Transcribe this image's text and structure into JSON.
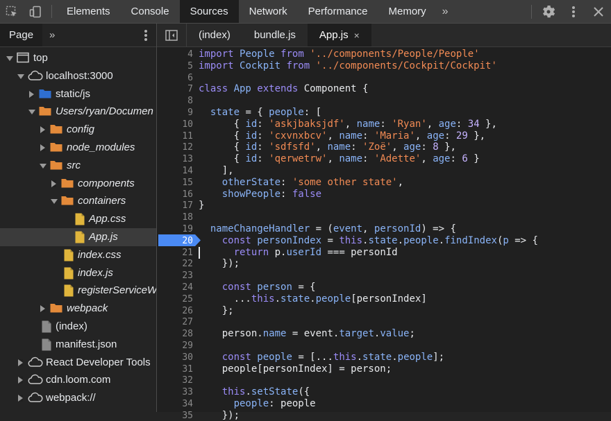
{
  "toolbar": {
    "tabs": [
      "Elements",
      "Console",
      "Sources",
      "Network",
      "Performance",
      "Memory"
    ],
    "active_tab": "Sources",
    "more_label": "»"
  },
  "navigator": {
    "tab_label": "Page",
    "more_label": "»",
    "tree": [
      {
        "label": "top",
        "depth": 0,
        "expanded": true,
        "icon": "frame-icon"
      },
      {
        "label": "localhost:3000",
        "depth": 1,
        "expanded": true,
        "icon": "cloud-icon"
      },
      {
        "label": "static/js",
        "depth": 2,
        "expanded": false,
        "icon": "folder-blue-icon"
      },
      {
        "label": "Users/ryan/Documen",
        "depth": 2,
        "expanded": true,
        "icon": "folder-orange-icon",
        "italic": true
      },
      {
        "label": "config",
        "depth": 3,
        "expanded": false,
        "icon": "folder-orange-icon",
        "italic": true
      },
      {
        "label": "node_modules",
        "depth": 3,
        "expanded": false,
        "icon": "folder-orange-icon",
        "italic": true
      },
      {
        "label": "src",
        "depth": 3,
        "expanded": true,
        "icon": "folder-orange-icon",
        "italic": true
      },
      {
        "label": "components",
        "depth": 4,
        "expanded": false,
        "icon": "folder-orange-icon",
        "italic": true
      },
      {
        "label": "containers",
        "depth": 4,
        "expanded": true,
        "icon": "folder-orange-icon",
        "italic": true
      },
      {
        "label": "App.css",
        "depth": 5,
        "icon": "file-icon",
        "italic": true
      },
      {
        "label": "App.js",
        "depth": 5,
        "icon": "file-icon",
        "italic": true,
        "selected": true
      },
      {
        "label": "index.css",
        "depth": 4,
        "icon": "file-icon",
        "italic": true
      },
      {
        "label": "index.js",
        "depth": 4,
        "icon": "file-icon",
        "italic": true
      },
      {
        "label": "registerServiceW",
        "depth": 4,
        "icon": "file-icon",
        "italic": true
      },
      {
        "label": "webpack",
        "depth": 3,
        "expanded": false,
        "icon": "folder-orange-icon",
        "italic": true
      },
      {
        "label": "(index)",
        "depth": 2,
        "icon": "file-gray-icon"
      },
      {
        "label": "manifest.json",
        "depth": 2,
        "icon": "file-gray-icon"
      },
      {
        "label": "React Developer Tools",
        "depth": 1,
        "expanded": false,
        "icon": "cloud-icon"
      },
      {
        "label": "cdn.loom.com",
        "depth": 1,
        "expanded": false,
        "icon": "cloud-icon"
      },
      {
        "label": "webpack://",
        "depth": 1,
        "expanded": false,
        "icon": "cloud-icon"
      }
    ]
  },
  "editor": {
    "tabs": [
      {
        "label": "(index)",
        "active": false
      },
      {
        "label": "bundle.js",
        "active": false
      },
      {
        "label": "App.js",
        "active": true,
        "close": "×"
      }
    ],
    "breakpoint_line": 20,
    "cursor_line": 21,
    "lines": [
      {
        "n": "4",
        "tokens": [
          [
            "k",
            "import "
          ],
          [
            "p",
            "People "
          ],
          [
            "k",
            "from "
          ],
          [
            "s",
            "'../components/People/People'"
          ]
        ]
      },
      {
        "n": "5",
        "tokens": [
          [
            "k",
            "import "
          ],
          [
            "p",
            "Cockpit "
          ],
          [
            "k",
            "from "
          ],
          [
            "s",
            "'../components/Cockpit/Cockpit'"
          ]
        ]
      },
      {
        "n": "6",
        "tokens": []
      },
      {
        "n": "7",
        "tokens": [
          [
            "k",
            "class "
          ],
          [
            "p",
            "App "
          ],
          [
            "k",
            "extends "
          ],
          [
            "m",
            "Component {"
          ]
        ]
      },
      {
        "n": "8",
        "tokens": []
      },
      {
        "n": "9",
        "tokens": [
          [
            "m",
            "  "
          ],
          [
            "p",
            "state "
          ],
          [
            "m",
            "= { "
          ],
          [
            "p",
            "people"
          ],
          [
            "m",
            ": ["
          ]
        ]
      },
      {
        "n": "10",
        "tokens": [
          [
            "m",
            "      { "
          ],
          [
            "p",
            "id"
          ],
          [
            "m",
            ": "
          ],
          [
            "s",
            "'askjbaksjdf'"
          ],
          [
            "m",
            ", "
          ],
          [
            "p",
            "name"
          ],
          [
            "m",
            ": "
          ],
          [
            "s",
            "'Ryan'"
          ],
          [
            "m",
            ", "
          ],
          [
            "p",
            "age"
          ],
          [
            "m",
            ": "
          ],
          [
            "n",
            "34"
          ],
          [
            "m",
            " },"
          ]
        ]
      },
      {
        "n": "11",
        "tokens": [
          [
            "m",
            "      { "
          ],
          [
            "p",
            "id"
          ],
          [
            "m",
            ": "
          ],
          [
            "s",
            "'cxvnxbcv'"
          ],
          [
            "m",
            ", "
          ],
          [
            "p",
            "name"
          ],
          [
            "m",
            ": "
          ],
          [
            "s",
            "'Maria'"
          ],
          [
            "m",
            ", "
          ],
          [
            "p",
            "age"
          ],
          [
            "m",
            ": "
          ],
          [
            "n",
            "29"
          ],
          [
            "m",
            " },"
          ]
        ]
      },
      {
        "n": "12",
        "tokens": [
          [
            "m",
            "      { "
          ],
          [
            "p",
            "id"
          ],
          [
            "m",
            ": "
          ],
          [
            "s",
            "'sdfsfd'"
          ],
          [
            "m",
            ", "
          ],
          [
            "p",
            "name"
          ],
          [
            "m",
            ": "
          ],
          [
            "s",
            "'Zoë'"
          ],
          [
            "m",
            ", "
          ],
          [
            "p",
            "age"
          ],
          [
            "m",
            ": "
          ],
          [
            "n",
            "8"
          ],
          [
            "m",
            " },"
          ]
        ]
      },
      {
        "n": "13",
        "tokens": [
          [
            "m",
            "      { "
          ],
          [
            "p",
            "id"
          ],
          [
            "m",
            ": "
          ],
          [
            "s",
            "'qerwetrw'"
          ],
          [
            "m",
            ", "
          ],
          [
            "p",
            "name"
          ],
          [
            "m",
            ": "
          ],
          [
            "s",
            "'Adette'"
          ],
          [
            "m",
            ", "
          ],
          [
            "p",
            "age"
          ],
          [
            "m",
            ": "
          ],
          [
            "n",
            "6"
          ],
          [
            "m",
            " }"
          ]
        ]
      },
      {
        "n": "14",
        "tokens": [
          [
            "m",
            "    ],"
          ]
        ]
      },
      {
        "n": "15",
        "tokens": [
          [
            "m",
            "    "
          ],
          [
            "p",
            "otherState"
          ],
          [
            "m",
            ": "
          ],
          [
            "s",
            "'some other state'"
          ],
          [
            "m",
            ","
          ]
        ]
      },
      {
        "n": "16",
        "tokens": [
          [
            "m",
            "    "
          ],
          [
            "p",
            "showPeople"
          ],
          [
            "m",
            ": "
          ],
          [
            "k",
            "false"
          ]
        ]
      },
      {
        "n": "17",
        "tokens": [
          [
            "m",
            "}"
          ]
        ]
      },
      {
        "n": "18",
        "tokens": []
      },
      {
        "n": "19",
        "tokens": [
          [
            "m",
            "  "
          ],
          [
            "p",
            "nameChangeHandler "
          ],
          [
            "m",
            "= ("
          ],
          [
            "p",
            "event"
          ],
          [
            "m",
            ", "
          ],
          [
            "p",
            "personId"
          ],
          [
            "m",
            ") => {"
          ]
        ]
      },
      {
        "n": "20",
        "tokens": [
          [
            "m",
            "    "
          ],
          [
            "k",
            "const "
          ],
          [
            "p",
            "personIndex "
          ],
          [
            "m",
            "= "
          ],
          [
            "k",
            "this"
          ],
          [
            "m",
            "."
          ],
          [
            "p",
            "state"
          ],
          [
            "m",
            "."
          ],
          [
            "p",
            "people"
          ],
          [
            "m",
            "."
          ],
          [
            "p",
            "findIndex"
          ],
          [
            "m",
            "("
          ],
          [
            "p",
            "p "
          ],
          [
            "m",
            "=> {"
          ]
        ]
      },
      {
        "n": "21",
        "tokens": [
          [
            "m",
            "      "
          ],
          [
            "k",
            "return "
          ],
          [
            "m",
            "p."
          ],
          [
            "p",
            "userId "
          ],
          [
            "m",
            "=== personId"
          ]
        ]
      },
      {
        "n": "22",
        "tokens": [
          [
            "m",
            "    });"
          ]
        ]
      },
      {
        "n": "23",
        "tokens": []
      },
      {
        "n": "24",
        "tokens": [
          [
            "m",
            "    "
          ],
          [
            "k",
            "const "
          ],
          [
            "p",
            "person "
          ],
          [
            "m",
            "= {"
          ]
        ]
      },
      {
        "n": "25",
        "tokens": [
          [
            "m",
            "      ..."
          ],
          [
            "k",
            "this"
          ],
          [
            "m",
            "."
          ],
          [
            "p",
            "state"
          ],
          [
            "m",
            "."
          ],
          [
            "p",
            "people"
          ],
          [
            "m",
            "[personIndex]"
          ]
        ]
      },
      {
        "n": "26",
        "tokens": [
          [
            "m",
            "    };"
          ]
        ]
      },
      {
        "n": "27",
        "tokens": []
      },
      {
        "n": "28",
        "tokens": [
          [
            "m",
            "    person."
          ],
          [
            "p",
            "name "
          ],
          [
            "m",
            "= event."
          ],
          [
            "p",
            "target"
          ],
          [
            "m",
            "."
          ],
          [
            "p",
            "value"
          ],
          [
            "m",
            ";"
          ]
        ]
      },
      {
        "n": "29",
        "tokens": []
      },
      {
        "n": "30",
        "tokens": [
          [
            "m",
            "    "
          ],
          [
            "k",
            "const "
          ],
          [
            "p",
            "people "
          ],
          [
            "m",
            "= [..."
          ],
          [
            "k",
            "this"
          ],
          [
            "m",
            "."
          ],
          [
            "p",
            "state"
          ],
          [
            "m",
            "."
          ],
          [
            "p",
            "people"
          ],
          [
            "m",
            "];"
          ]
        ]
      },
      {
        "n": "31",
        "tokens": [
          [
            "m",
            "    people[personIndex] = person;"
          ]
        ]
      },
      {
        "n": "32",
        "tokens": []
      },
      {
        "n": "33",
        "tokens": [
          [
            "m",
            "    "
          ],
          [
            "k",
            "this"
          ],
          [
            "m",
            "."
          ],
          [
            "p",
            "setState"
          ],
          [
            "m",
            "({"
          ]
        ]
      },
      {
        "n": "34",
        "tokens": [
          [
            "m",
            "      "
          ],
          [
            "p",
            "people"
          ],
          [
            "m",
            ": people"
          ]
        ]
      },
      {
        "n": "35",
        "tokens": [
          [
            "m",
            "    });"
          ]
        ]
      }
    ]
  },
  "colors": {
    "breakpoint": "#4a8af4",
    "folder_orange": "#e38a3a",
    "folder_blue": "#2f6fd1",
    "file": "#e0b53c",
    "file_gray": "#8a8a8a"
  }
}
